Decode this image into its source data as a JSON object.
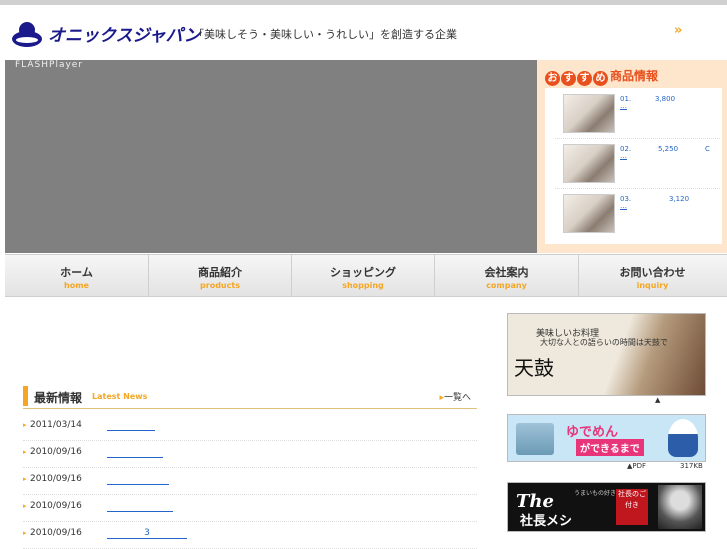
{
  "header": {
    "company_name": "オニックスジャパン",
    "tagline": "「美味しそう・美味しい・うれしい」を創造する企業",
    "next_icon": "double-chevron-right-icon"
  },
  "flash": {
    "label": "FLASHPlayer"
  },
  "recommend": {
    "title_bubbles": [
      "お",
      "す",
      "す",
      "め"
    ],
    "title_text": "商品情報",
    "items": [
      {
        "num": "01.",
        "price": "3,800",
        "suffix": "",
        "link": "…"
      },
      {
        "num": "02.",
        "price": "5,250",
        "suffix": "C",
        "link": "…"
      },
      {
        "num": "03.",
        "price": "3,120",
        "suffix": "",
        "link": "…"
      }
    ]
  },
  "nav": {
    "items": [
      {
        "ja": "ホーム",
        "en": "home"
      },
      {
        "ja": "商品紹介",
        "en": "products"
      },
      {
        "ja": "ショッピング",
        "en": "shopping"
      },
      {
        "ja": "会社案内",
        "en": "company"
      },
      {
        "ja": "お問い合わせ",
        "en": "inquiry"
      }
    ]
  },
  "news": {
    "title": "最新情報",
    "subtitle": "Latest News",
    "view_all": "一覧へ",
    "rows": [
      {
        "date": "2011/03/14",
        "link": ""
      },
      {
        "date": "2010/09/16",
        "link": ""
      },
      {
        "date": "2010/09/16",
        "link": ""
      },
      {
        "date": "2010/09/16",
        "link": ""
      },
      {
        "date": "2010/09/16",
        "link": "3"
      }
    ]
  },
  "banners": {
    "tenten": {
      "line1": "美味しいお料理",
      "line2": "大切な人との語らいの時間は天鼓で",
      "brand": "天鼓",
      "caret": "▲"
    },
    "yudemen": {
      "line1": "ゆでめん",
      "line2": "ができるまで",
      "caret": "▲PDF",
      "size": "317KB"
    },
    "shacho": {
      "the": "The",
      "name": "社長メシ",
      "small": "うまいもの好き社長が",
      "badge": "社長のご付き"
    }
  },
  "colors": {
    "accent": "#f5a623",
    "logo": "#1a1a8c",
    "link": "#2266cc",
    "reco_bg": "#fde6cc"
  }
}
